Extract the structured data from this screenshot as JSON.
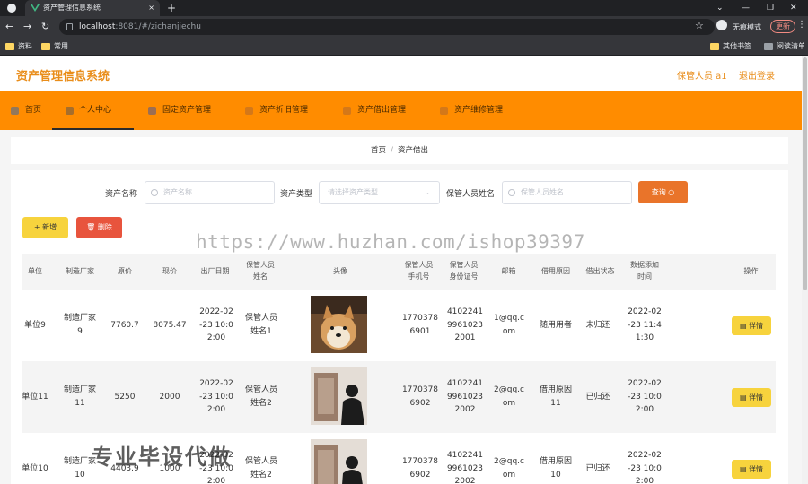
{
  "browser": {
    "tab_title": "资产管理信息系统",
    "tab_close": "×",
    "new_tab": "+",
    "url_host": "localhost",
    "url_path": ":8081/#/zichanjiechu",
    "incognito": "无痕模式",
    "update": "更新",
    "bookmarks": [
      "资料",
      "常用"
    ],
    "bookmarks_right": [
      "其他书签",
      "阅读清单"
    ],
    "win_min": "—",
    "win_max": "❐",
    "win_close": "✕",
    "win_down": "⌄"
  },
  "app": {
    "title": "资产管理信息系统",
    "user": "保管人员 a1",
    "logout": "退出登录"
  },
  "nav": [
    {
      "label": "首页",
      "icon": "home-icon"
    },
    {
      "label": "个人中心",
      "icon": "user-icon"
    },
    {
      "label": "固定资产管理",
      "icon": "list-icon"
    },
    {
      "label": "资产折旧管理",
      "icon": "list-icon"
    },
    {
      "label": "资产借出管理",
      "icon": "list-icon"
    },
    {
      "label": "资产维修管理",
      "icon": "list-icon"
    }
  ],
  "breadcrumb": {
    "home": "首页",
    "sep": "/",
    "current": "资产借出"
  },
  "filters": {
    "asset_name_label": "资产名称",
    "asset_name_placeholder": "资产名称",
    "asset_type_label": "资产类型",
    "asset_type_placeholder": "请选择资产类型",
    "keeper_label": "保管人员姓名",
    "keeper_placeholder": "保管人员姓名",
    "query": "查询"
  },
  "actions": {
    "add": "+ 新增",
    "delete": "删除"
  },
  "watermarks": {
    "url": "https://www.huzhan.com/ishop39397",
    "cn": "专业毕设代做"
  },
  "table": {
    "headers": [
      "单位",
      "制造厂家",
      "原价",
      "现价",
      "出厂日期",
      "保管人员\n姓名",
      "头像",
      "保管人员\n手机号",
      "保管人员\n身份证号",
      "邮箱",
      "借用原因",
      "借出状态",
      "数据添加\n时间",
      "操作"
    ],
    "detail_label": "详情",
    "rows": [
      {
        "unit": "单位9",
        "maker": "制造厂家\n9",
        "orig": "7760.7",
        "now": "8075.47",
        "date": "2022-02\n-23 10:0\n2:00",
        "keeper": "保管人员\n姓名1",
        "phone": "1770378\n6901",
        "idno": "4102241\n9961023\n2001",
        "email": "1@qq.c\nom",
        "reason": "随用用者",
        "status": "未归还",
        "added": "2022-02\n-23 11:4\n1:30"
      },
      {
        "unit": "单位11",
        "maker": "制造厂家\n11",
        "orig": "5250",
        "now": "2000",
        "date": "2022-02\n-23 10:0\n2:00",
        "keeper": "保管人员\n姓名2",
        "phone": "1770378\n6902",
        "idno": "4102241\n9961023\n2002",
        "email": "2@qq.c\nom",
        "reason": "借用原因\n11",
        "status": "已归还",
        "added": "2022-02\n-23 10:0\n2:00"
      },
      {
        "unit": "单位10",
        "maker": "制造厂家\n10",
        "orig": "4403.9",
        "now": "1000",
        "date": "2022-02\n-23 10:0\n2:00",
        "keeper": "保管人员\n姓名2",
        "phone": "1770378\n6902",
        "idno": "4102241\n9961023\n2002",
        "email": "2@qq.c\nom",
        "reason": "借用原因\n10",
        "status": "已归还",
        "added": "2022-02\n-23 10:0\n2:00"
      }
    ]
  },
  "colors": {
    "accent": "#ff8c00",
    "title": "#e98d1a",
    "query": "#e9742a",
    "add": "#f7d33d",
    "delete": "#e8543d"
  }
}
